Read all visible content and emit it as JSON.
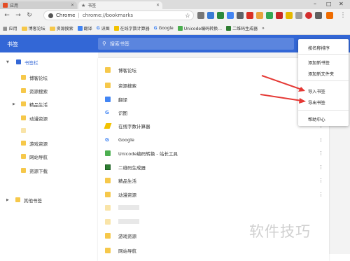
{
  "tabs": {
    "inactive": {
      "label": "应用"
    },
    "active": {
      "label": "书签"
    }
  },
  "toolbar": {
    "omnibox_site": "Chrome",
    "omnibox_url": "chrome://bookmarks"
  },
  "bookmarks_bar": {
    "items": [
      "应用",
      "博客论坛",
      "资源搜索",
      "翻译",
      "识图",
      "在线字数计算器",
      "Google",
      "Unicode编码转换…",
      "二维码生成器"
    ]
  },
  "app": {
    "title": "书签",
    "search_placeholder": "搜索书签"
  },
  "sidebar": {
    "items": [
      {
        "label": "书签栏",
        "selected": true
      },
      {
        "label": "博客论坛"
      },
      {
        "label": "资源搜索"
      },
      {
        "label": "精品生活"
      },
      {
        "label": "动漫资源"
      },
      {
        "label": ""
      },
      {
        "label": "游戏资源"
      },
      {
        "label": "网站导航"
      },
      {
        "label": "资源下载"
      },
      {
        "label": "其他书签"
      }
    ]
  },
  "list": {
    "rows": [
      {
        "name": "博客论坛",
        "icon": "folder-icon"
      },
      {
        "name": "资源搜索",
        "icon": "folder-icon"
      },
      {
        "name": "翻译",
        "icon": "translate-icon"
      },
      {
        "name": "识图",
        "icon": "google-icon"
      },
      {
        "name": "在线字数计算器",
        "icon": "pencil-icon"
      },
      {
        "name": "Google",
        "icon": "google-icon"
      },
      {
        "name": "Unicode编码转换 - 站长工具",
        "icon": "site-icon"
      },
      {
        "name": "二维码生成器",
        "icon": "qr-icon"
      },
      {
        "name": "精品生活",
        "icon": "folder-icon"
      },
      {
        "name": "动漫资源",
        "icon": "folder-icon"
      },
      {
        "name": "",
        "icon": "folder-icon"
      },
      {
        "name": "",
        "icon": "folder-icon"
      },
      {
        "name": "游戏资源",
        "icon": "folder-icon"
      },
      {
        "name": "网站导航",
        "icon": "folder-icon"
      }
    ]
  },
  "menu": {
    "items": [
      "按名称排序",
      "添加新书签",
      "添加新文件夹",
      "导入书签",
      "导出书签",
      "帮助中心"
    ]
  },
  "watermark": "软件技巧",
  "colors": {
    "accent": "#3367d6",
    "arrow": "#e53935",
    "folder": "#f6c84a"
  }
}
